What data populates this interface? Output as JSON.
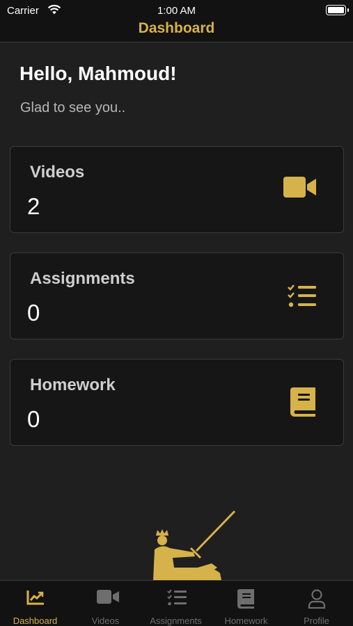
{
  "status_bar": {
    "carrier": "Carrier",
    "time": "1:00 AM",
    "wifi_icon": "wifi-icon",
    "battery_icon": "battery-icon",
    "battery_level": 1.0
  },
  "nav": {
    "title": "Dashboard"
  },
  "greeting": {
    "title": "Hello, Mahmoud!",
    "subtitle": "Glad to see you.."
  },
  "cards": [
    {
      "label": "Videos",
      "count": "2",
      "icon": "video-camera-icon"
    },
    {
      "label": "Assignments",
      "count": "0",
      "icon": "checklist-icon"
    },
    {
      "label": "Homework",
      "count": "0",
      "icon": "book-icon"
    }
  ],
  "mascot": {
    "icon": "knight-on-horse-logo"
  },
  "tabs": [
    {
      "label": "Dashboard",
      "icon": "chart-line-icon",
      "active": true
    },
    {
      "label": "Videos",
      "icon": "video-camera-icon",
      "active": false
    },
    {
      "label": "Assignments",
      "icon": "checklist-icon",
      "active": false
    },
    {
      "label": "Homework",
      "icon": "book-icon",
      "active": false
    },
    {
      "label": "Profile",
      "icon": "user-icon",
      "active": false
    }
  ],
  "colors": {
    "accent": "#d6b24a",
    "background": "#1f1f1f",
    "card_background": "#161616",
    "inactive_tab": "#6e6e6e"
  }
}
